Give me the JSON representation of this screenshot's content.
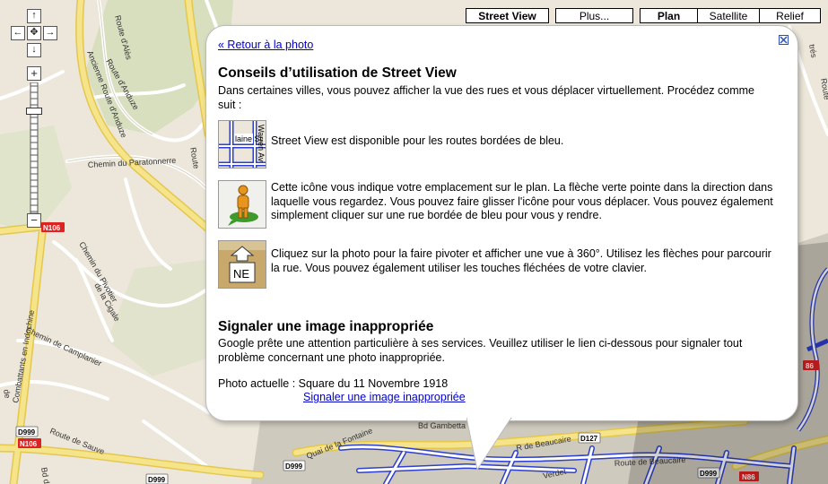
{
  "map_type_controls": {
    "street_view": "Street View",
    "more": "Plus...",
    "map": "Plan",
    "satellite": "Satellite",
    "terrain": "Relief"
  },
  "nav": {
    "up": "↑",
    "down": "↓",
    "left": "←",
    "right": "→",
    "center": "✥",
    "zoom_in": "+",
    "zoom_out": "−"
  },
  "zoom_level_fraction": 0.2,
  "map_labels": {
    "route_ales": "Route d'Alès",
    "ancienne_route_anduze": "Ancienne Route d'Anduze",
    "route_anduze": "Route d'Anduze",
    "chemin_paratonnerre": "Chemin du Paratonnerre",
    "route_short": "Route",
    "combattants": "Combattants en Indochine",
    "chemin_pivotier": "Chemin du Pivotier",
    "la_cigale": "de la Cigale",
    "chemin_camplanier": "Chemin de Camplanier",
    "route_sauve": "Route de Sauve",
    "bd_gambetta": "Bd Gambetta",
    "quai_fontaine": "Quai de la Fontaine",
    "r_beaucaire": "R de Beaucaire",
    "route_beaucaire": "Route de Beaucaire",
    "verdet": "Verdet",
    "bd_de": "Bd de",
    "de_edge": "de",
    "tres_edge": "trés",
    "route_edge": "Route"
  },
  "road_shields": {
    "n106_a": "N106",
    "n106_b": "N106",
    "d999_a": "D999",
    "d999_b": "D999",
    "d999_c": "D999",
    "d999_d": "D999",
    "d127": "D127",
    "n86": "N86",
    "n86_b": "86"
  },
  "infowindow": {
    "back_link": "« Retour à la photo",
    "heading1": "Conseils d’utilisation de Street View",
    "intro": "Dans certaines villes, vous pouvez afficher la vue des rues et vous déplacer virtuellement. Procédez comme suit :",
    "tip1": "Street View est disponible pour les routes bordées de bleu.",
    "tip2": "Cette icône vous indique votre emplacement sur le plan. La flèche verte pointe dans la direction dans laquelle vous regardez. Vous pouvez faire glisser l'icône pour vous déplacer. Vous pouvez également simplement cliquer sur une rue bordée de bleu pour vous y rendre.",
    "tip3": "Cliquez sur la photo pour la faire pivoter et afficher une vue à 360°. Utilisez les flèches pour parcourir la rue. Vous pouvez également utiliser les touches fléchées de votre clavier.",
    "heading2": "Signaler une image inappropriée",
    "report_text": "Google prête une attention particulière à ses services. Veuillez utiliser le lien ci-dessous pour signaler tout problème concernant une photo inappropriée.",
    "photo_label": "Photo actuelle : Square du 11 Novembre 1918",
    "report_link": "Signaler une image inappropriée",
    "thumb1_labels": {
      "street1": "laine St",
      "street2": "Warren Av"
    },
    "thumb3_label": "NE"
  }
}
